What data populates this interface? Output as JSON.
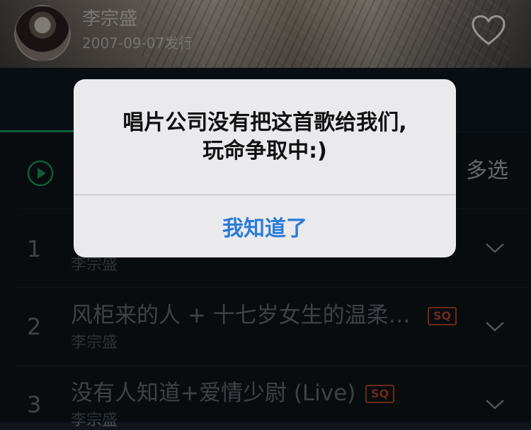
{
  "header": {
    "artist": "李宗盛",
    "release": "2007-09-07发行",
    "favorite_icon": "heart-outline-icon"
  },
  "toolbar": {
    "play_all_icon": "play-circle-icon",
    "play_all_label": "",
    "multi_select": "多选"
  },
  "songs": [
    {
      "index": "1",
      "title": "",
      "artist": "李宗盛",
      "badge": ""
    },
    {
      "index": "2",
      "title": "风柜来的人 + 十七岁女生的温柔…",
      "artist": "李宗盛",
      "badge": "SQ"
    },
    {
      "index": "3",
      "title": "没有人知道+爱情少尉 (Live)",
      "artist": "李宗盛",
      "badge": "SQ"
    }
  ],
  "dialog": {
    "message_line1": "唱片公司没有把这首歌给我们,",
    "message_line2": "玩命争取中:)",
    "button": "我知道了"
  },
  "colors": {
    "accent_green": "#1a9f62",
    "sq_badge": "#b9492c",
    "dialog_button": "#2a7cd6"
  }
}
